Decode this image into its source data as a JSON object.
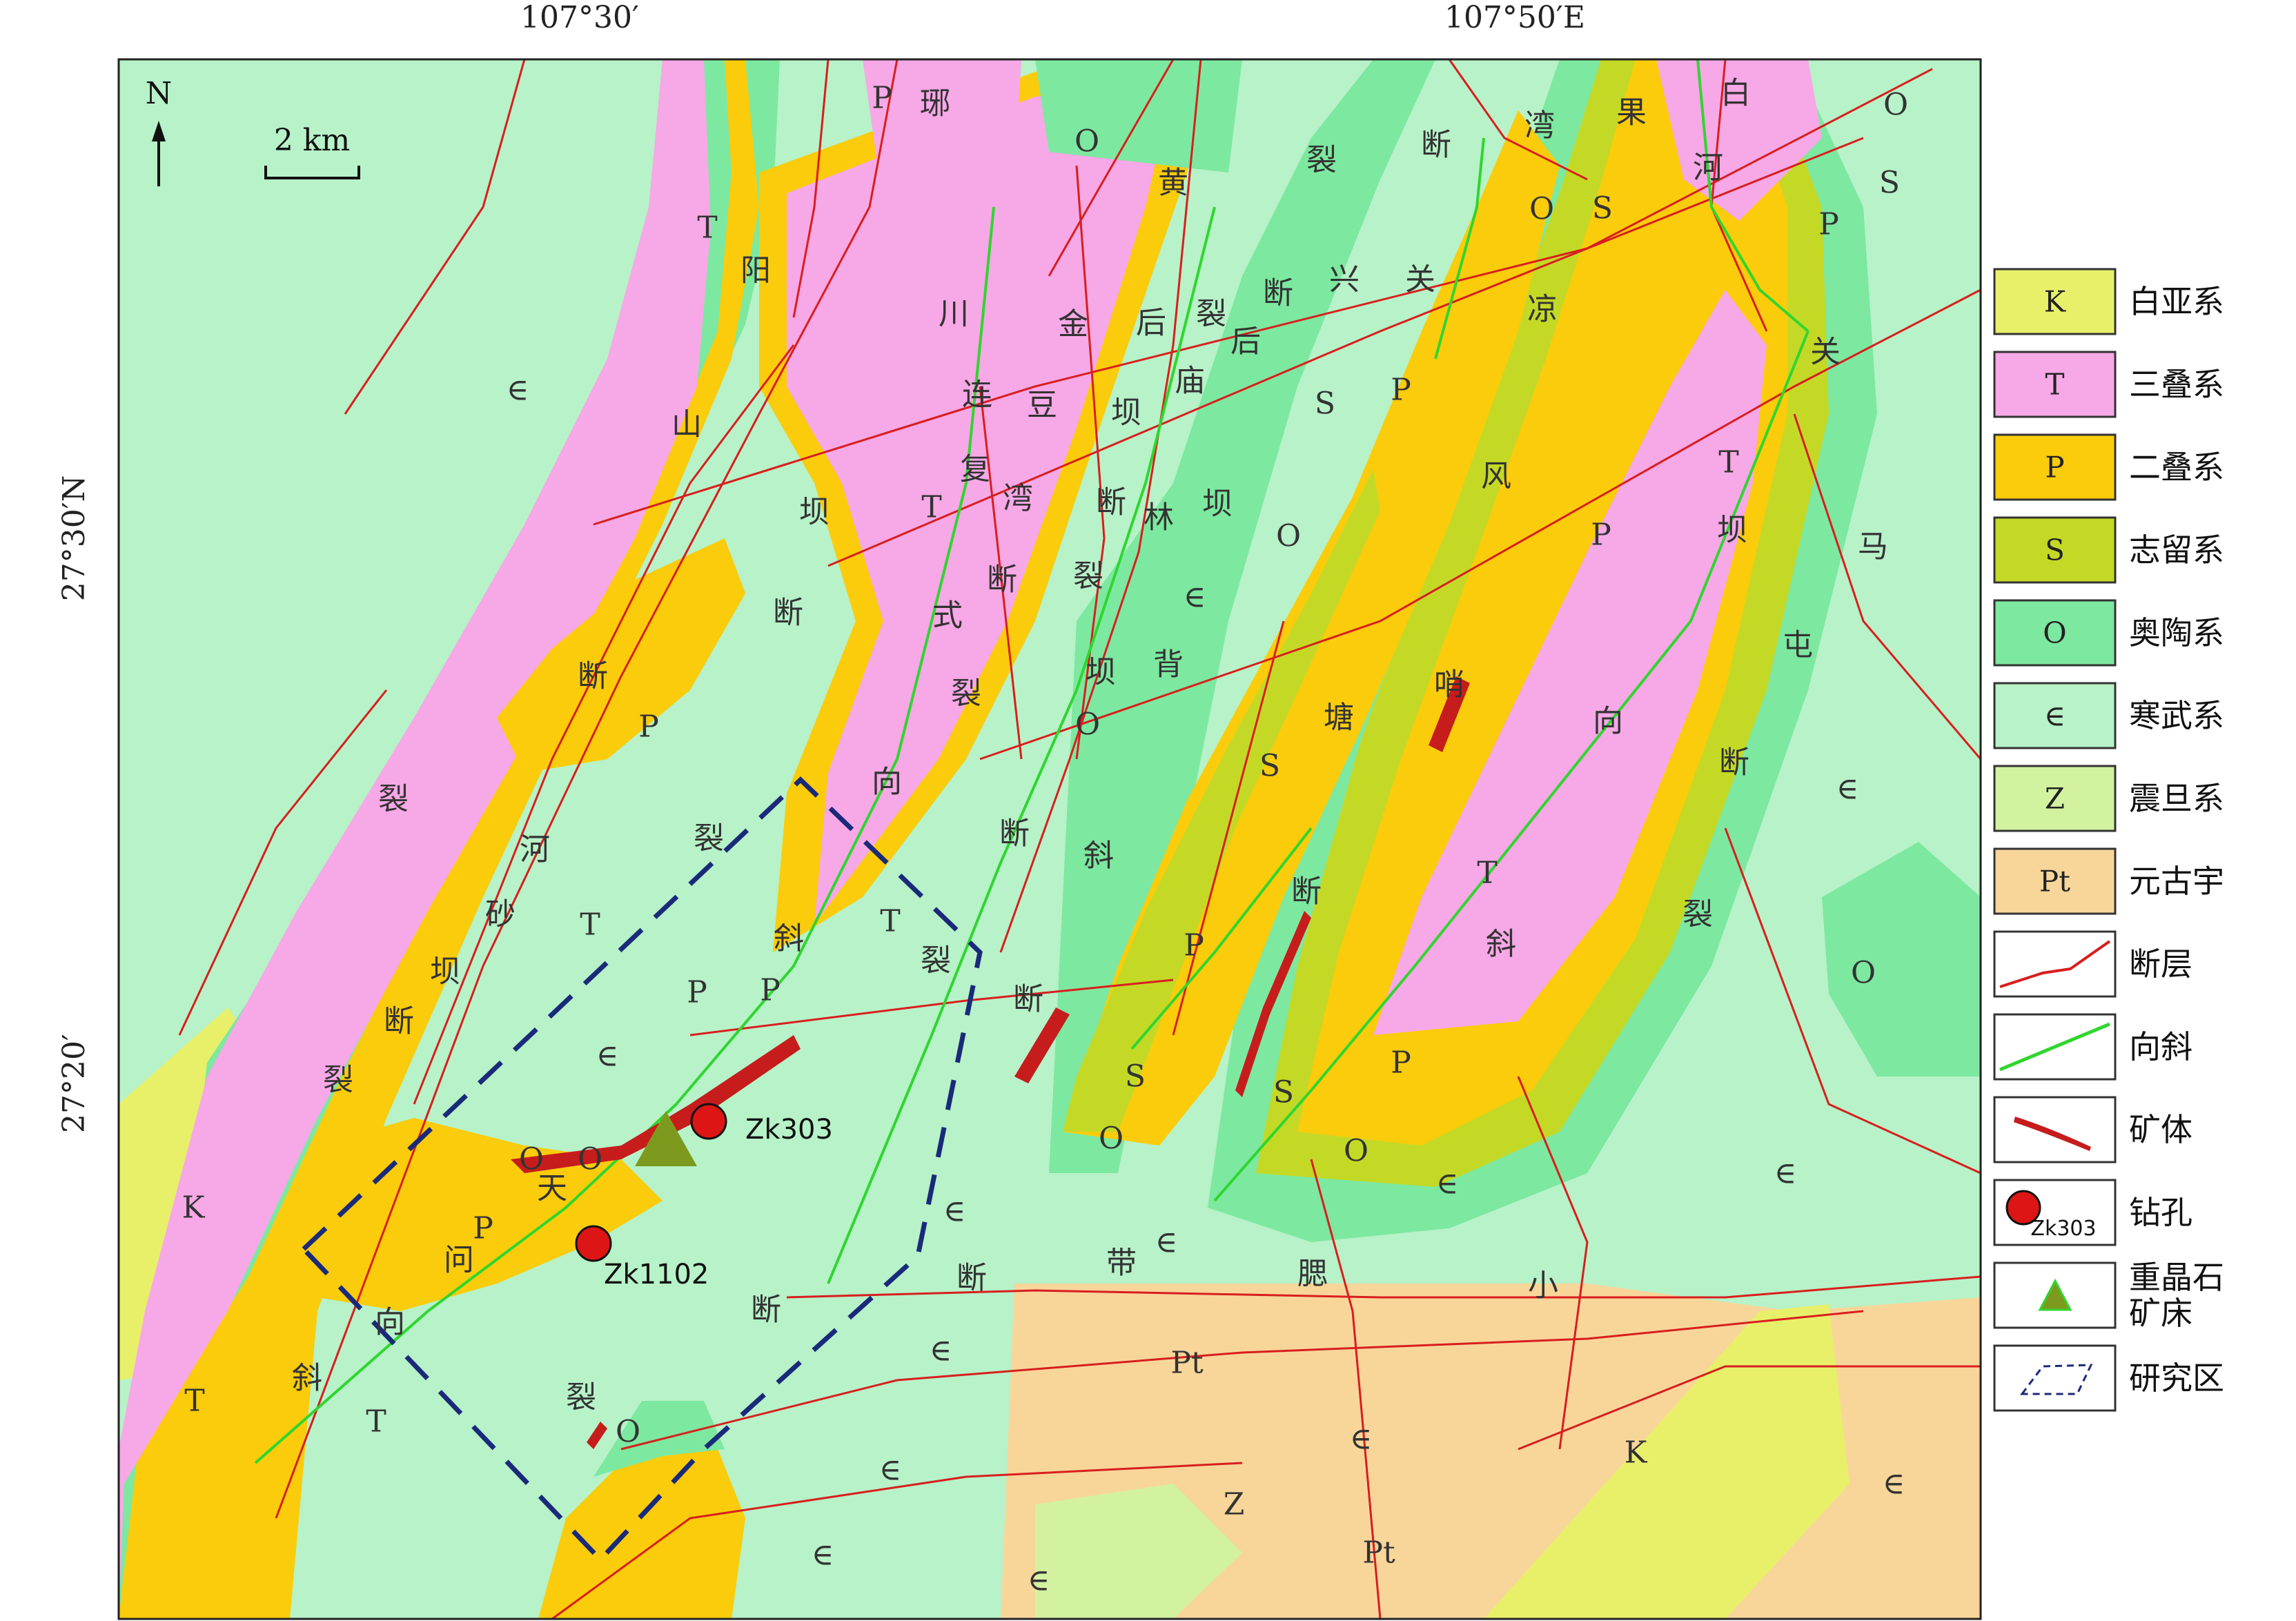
{
  "coordinates": {
    "top": [
      "107°30′",
      "107°50′E"
    ],
    "left": [
      "27°30′N",
      "27°20′"
    ]
  },
  "north": "N",
  "scale_label": "2 km",
  "units": [
    {
      "t": "K"
    },
    {
      "t": "K"
    },
    {
      "t": "T"
    },
    {
      "t": "T"
    },
    {
      "t": "T"
    },
    {
      "t": "T"
    },
    {
      "t": "T"
    },
    {
      "t": "T"
    },
    {
      "t": "T"
    },
    {
      "t": "T"
    },
    {
      "t": "P"
    },
    {
      "t": "P"
    },
    {
      "t": "P"
    },
    {
      "t": "P"
    },
    {
      "t": "P"
    },
    {
      "t": "P"
    },
    {
      "t": "P"
    },
    {
      "t": "P"
    },
    {
      "t": "P"
    },
    {
      "t": "P"
    },
    {
      "t": "S"
    },
    {
      "t": "S"
    },
    {
      "t": "S"
    },
    {
      "t": "S"
    },
    {
      "t": "S"
    },
    {
      "t": "S"
    },
    {
      "t": "O"
    },
    {
      "t": "O"
    },
    {
      "t": "O"
    },
    {
      "t": "O"
    },
    {
      "t": "O"
    },
    {
      "t": "O"
    },
    {
      "t": "O"
    },
    {
      "t": "O"
    },
    {
      "t": "O"
    },
    {
      "t": "O"
    },
    {
      "t": "O"
    },
    {
      "t": "∈"
    },
    {
      "t": "∈"
    },
    {
      "t": "∈"
    },
    {
      "t": "∈"
    },
    {
      "t": "∈"
    },
    {
      "t": "∈"
    },
    {
      "t": "∈"
    },
    {
      "t": "∈"
    },
    {
      "t": "∈"
    },
    {
      "t": "∈"
    },
    {
      "t": "∈"
    },
    {
      "t": "∈"
    },
    {
      "t": "∈"
    },
    {
      "t": "∈"
    },
    {
      "t": "Z"
    },
    {
      "t": "Pt"
    },
    {
      "t": "Pt"
    }
  ],
  "place_chars": [
    {
      "t": "琊"
    },
    {
      "t": "黄"
    },
    {
      "t": "裂"
    },
    {
      "t": "断"
    },
    {
      "t": "湾"
    },
    {
      "t": "果"
    },
    {
      "t": "白"
    },
    {
      "t": "河"
    },
    {
      "t": "阳"
    },
    {
      "t": "川"
    },
    {
      "t": "金"
    },
    {
      "t": "后"
    },
    {
      "t": "裂"
    },
    {
      "t": "断"
    },
    {
      "t": "兴"
    },
    {
      "t": "关"
    },
    {
      "t": "凉"
    },
    {
      "t": "关"
    },
    {
      "t": "后"
    },
    {
      "t": "庙"
    },
    {
      "t": "坝"
    },
    {
      "t": "豆"
    },
    {
      "t": "连"
    },
    {
      "t": "山"
    },
    {
      "t": "复"
    },
    {
      "t": "湾"
    },
    {
      "t": "断"
    },
    {
      "t": "林"
    },
    {
      "t": "坝"
    },
    {
      "t": "坝"
    },
    {
      "t": "风"
    },
    {
      "t": "坝"
    },
    {
      "t": "马"
    },
    {
      "t": "断"
    },
    {
      "t": "式"
    },
    {
      "t": "断"
    },
    {
      "t": "裂"
    },
    {
      "t": "坝"
    },
    {
      "t": "背"
    },
    {
      "t": "断"
    },
    {
      "t": "裂"
    },
    {
      "t": "哨"
    },
    {
      "t": "塘"
    },
    {
      "t": "屯"
    },
    {
      "t": "向"
    },
    {
      "t": "断"
    },
    {
      "t": "裂"
    },
    {
      "t": "向"
    },
    {
      "t": "河"
    },
    {
      "t": "裂"
    },
    {
      "t": "断"
    },
    {
      "t": "斜"
    },
    {
      "t": "砂"
    },
    {
      "t": "坝"
    },
    {
      "t": "斜"
    },
    {
      "t": "裂"
    },
    {
      "t": "断"
    },
    {
      "t": "断"
    },
    {
      "t": "斜"
    },
    {
      "t": "裂"
    },
    {
      "t": "断"
    },
    {
      "t": "裂"
    },
    {
      "t": "天"
    },
    {
      "t": "问"
    },
    {
      "t": "断"
    },
    {
      "t": "带"
    },
    {
      "t": "腮"
    },
    {
      "t": "小"
    },
    {
      "t": "向"
    },
    {
      "t": "断"
    },
    {
      "t": "斜"
    },
    {
      "t": "裂"
    }
  ],
  "wells": [
    {
      "label": "Zk303"
    },
    {
      "label": "Zk1102"
    }
  ],
  "legend": [
    {
      "sym": "K",
      "label": "白亚系",
      "color": "#E8F06A"
    },
    {
      "sym": "T",
      "label": "三叠系",
      "color": "#F7A8E6"
    },
    {
      "sym": "P",
      "label": "二叠系",
      "color": "#FACC0B"
    },
    {
      "sym": "S",
      "label": "志留系",
      "color": "#C4D926"
    },
    {
      "sym": "O",
      "label": "奥陶系",
      "color": "#7DE8A0"
    },
    {
      "sym": "∈",
      "label": "寒武系",
      "color": "#B7F2C8"
    },
    {
      "sym": "Z",
      "label": "震旦系",
      "color": "#D2F2A0"
    },
    {
      "sym": "Pt",
      "label": "元古宇",
      "color": "#F8D69A"
    },
    {
      "sym": "",
      "label": "断层",
      "color": "#D81E1E"
    },
    {
      "sym": "",
      "label": "向斜",
      "color": "#2FD62F"
    },
    {
      "sym": "",
      "label": "矿体",
      "color": "#C61C1C"
    },
    {
      "sym": "Zk303",
      "label": "钻孔",
      "color": "#DD1515"
    },
    {
      "sym": "",
      "label": "重晶石\n矿床",
      "color": "#7E9A1E"
    },
    {
      "sym": "",
      "label": "研究区",
      "color": "#1A2A7A"
    }
  ]
}
